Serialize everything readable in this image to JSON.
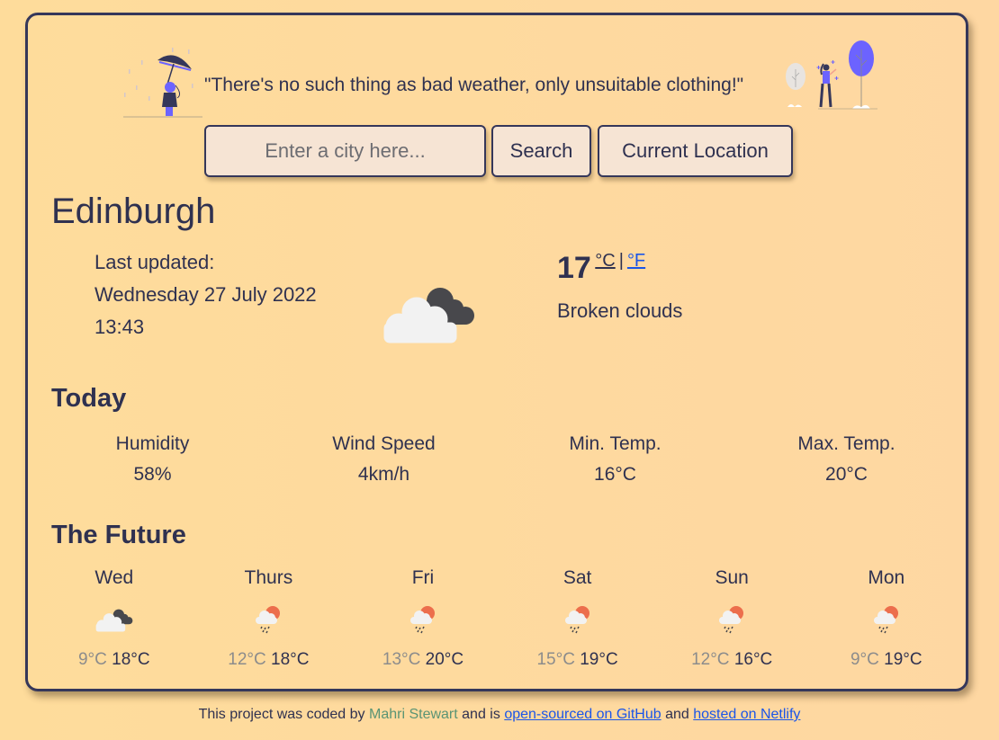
{
  "header": {
    "quote": "\"There's no such thing as bad weather, only unsuitable clothing!\""
  },
  "search": {
    "placeholder": "Enter a city here...",
    "search_label": "Search",
    "location_label": "Current Location"
  },
  "current": {
    "city": "Edinburgh",
    "last_updated_label": "Last updated:",
    "date": "Wednesday 27 July 2022",
    "time": "13:43",
    "temperature": "17",
    "unit_c": "°C",
    "unit_sep": "|",
    "unit_f": "°F",
    "description": "Broken clouds",
    "icon": "broken-clouds-icon"
  },
  "today": {
    "heading": "Today",
    "stats": [
      {
        "label": "Humidity",
        "value": "58%"
      },
      {
        "label": "Wind Speed",
        "value": "4km/h"
      },
      {
        "label": "Min. Temp.",
        "value": "16°C"
      },
      {
        "label": "Max. Temp.",
        "value": "20°C"
      }
    ]
  },
  "future": {
    "heading": "The Future",
    "days": [
      {
        "day": "Wed",
        "icon": "broken-clouds-icon",
        "min": "9°C",
        "max": "18°C"
      },
      {
        "day": "Thurs",
        "icon": "rain-sun-icon",
        "min": "12°C",
        "max": "18°C"
      },
      {
        "day": "Fri",
        "icon": "rain-sun-icon",
        "min": "13°C",
        "max": "20°C"
      },
      {
        "day": "Sat",
        "icon": "rain-sun-icon",
        "min": "15°C",
        "max": "19°C"
      },
      {
        "day": "Sun",
        "icon": "rain-sun-icon",
        "min": "12°C",
        "max": "16°C"
      },
      {
        "day": "Mon",
        "icon": "rain-sun-icon",
        "min": "9°C",
        "max": "19°C"
      }
    ]
  },
  "footer": {
    "prefix": "This project was coded by",
    "author": "Mahri Stewart",
    "middle": "and is",
    "github_link": "open-sourced on GitHub",
    "and": "and",
    "netlify_link": "hosted on Netlify"
  },
  "colors": {
    "background": "#fedc9b",
    "text": "#2f3150",
    "link": "#1a55e8",
    "author": "#5a9474",
    "sun": "#ec6e4c",
    "accent_illustration": "#6c63ff"
  }
}
